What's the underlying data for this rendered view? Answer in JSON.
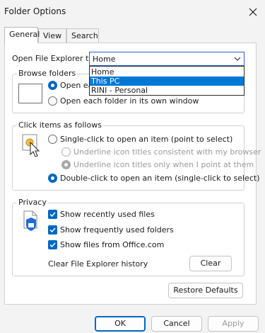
{
  "window": {
    "title": "Folder Options"
  },
  "tabs": [
    {
      "label": "General"
    },
    {
      "label": "View"
    },
    {
      "label": "Search"
    }
  ],
  "open_explorer": {
    "label": "Open File Explorer to:",
    "selected": "Home",
    "options": [
      "Home",
      "This PC",
      "RINI - Personal"
    ],
    "highlighted": "This PC"
  },
  "browse": {
    "title": "Browse folders",
    "option_same": "Open each folder in the same window",
    "option_same_visible": "Open ea",
    "option_own": "Open each folder in its own window"
  },
  "click": {
    "title": "Click items as follows",
    "single": "Single-click to open an item (point to select)",
    "underline_browser": "Underline icon titles consistent with my browser",
    "underline_point": "Underline icon titles only when I point at them",
    "double": "Double-click to open an item (single-click to select)"
  },
  "privacy": {
    "title": "Privacy",
    "recent": "Show recently used files",
    "frequent": "Show frequently used folders",
    "office": "Show files from Office.com",
    "clear_label": "Clear File Explorer history",
    "clear_button": "Clear"
  },
  "buttons": {
    "restore": "Restore Defaults",
    "ok": "OK",
    "cancel": "Cancel",
    "apply": "Apply"
  },
  "colors": {
    "accent": "#0067c0",
    "selection": "#0078d4"
  }
}
